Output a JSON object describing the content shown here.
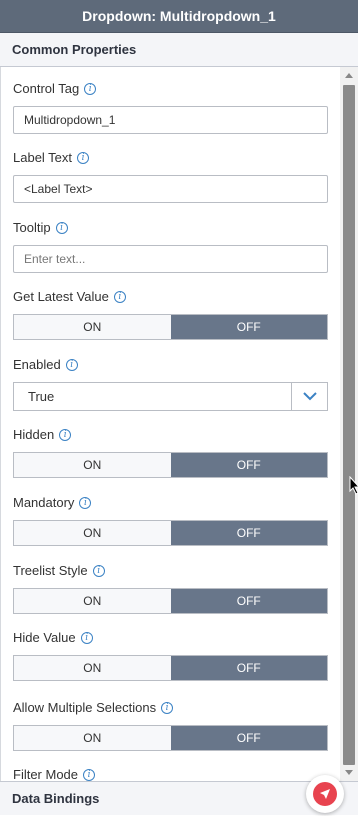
{
  "panel": {
    "title": "Dropdown: Multidropdown_1"
  },
  "sections": {
    "common": "Common Properties",
    "bindings": "Data Bindings"
  },
  "toggle_labels": {
    "on": "ON",
    "off": "OFF"
  },
  "fields": {
    "control_tag": {
      "label": "Control Tag",
      "value": "Multidropdown_1"
    },
    "label_text": {
      "label": "Label Text",
      "value": "<Label Text>"
    },
    "tooltip": {
      "label": "Tooltip",
      "placeholder": "Enter text..."
    },
    "get_latest_value": {
      "label": "Get Latest Value",
      "selected": "OFF"
    },
    "enabled": {
      "label": "Enabled",
      "value": "True"
    },
    "hidden": {
      "label": "Hidden",
      "selected": "OFF"
    },
    "mandatory": {
      "label": "Mandatory",
      "selected": "OFF"
    },
    "treelist_style": {
      "label": "Treelist Style",
      "selected": "OFF"
    },
    "hide_value": {
      "label": "Hide Value",
      "selected": "OFF"
    },
    "allow_multiple_selections": {
      "label": "Allow Multiple Selections",
      "selected": "OFF"
    },
    "filter_mode": {
      "label": "Filter Mode"
    }
  },
  "colors": {
    "header_bg": "#5e6a7a",
    "toggle_active": "#68768a",
    "info_icon": "#3b82c4",
    "fab": "#e8434f"
  },
  "icons": {
    "info": "info-icon",
    "dropdown": "chevron-down-icon",
    "fab": "send-icon"
  }
}
